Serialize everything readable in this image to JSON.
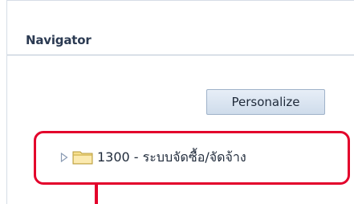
{
  "navigator": {
    "title": "Navigator",
    "personalize_label": "Personalize",
    "tree": {
      "items": [
        {
          "label": "1300 - ระบบจัดซื้อ/จัดจ้าง",
          "expand_icon": "triangle-right-icon",
          "icon": "folder-icon"
        }
      ]
    }
  },
  "annotation": {
    "color": "#e3002b"
  }
}
